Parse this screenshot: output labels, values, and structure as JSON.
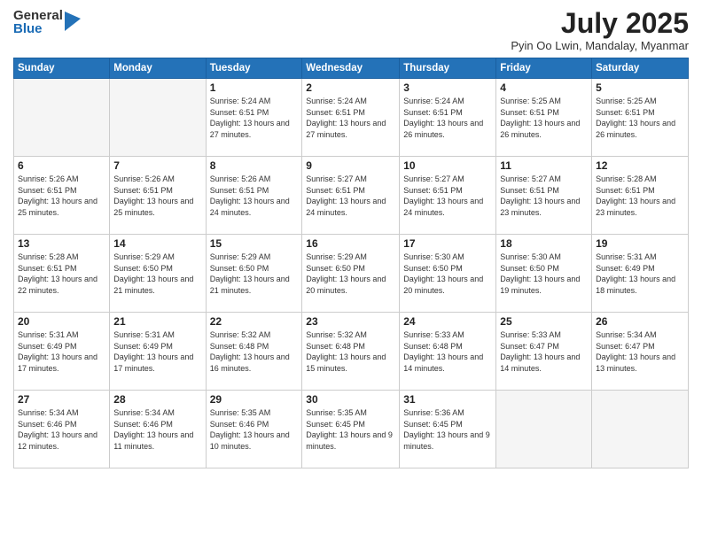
{
  "logo": {
    "general": "General",
    "blue": "Blue"
  },
  "title": {
    "month": "July 2025",
    "location": "Pyin Oo Lwin, Mandalay, Myanmar"
  },
  "headers": [
    "Sunday",
    "Monday",
    "Tuesday",
    "Wednesday",
    "Thursday",
    "Friday",
    "Saturday"
  ],
  "weeks": [
    [
      {
        "day": "",
        "info": ""
      },
      {
        "day": "",
        "info": ""
      },
      {
        "day": "1",
        "info": "Sunrise: 5:24 AM\nSunset: 6:51 PM\nDaylight: 13 hours and 27 minutes."
      },
      {
        "day": "2",
        "info": "Sunrise: 5:24 AM\nSunset: 6:51 PM\nDaylight: 13 hours and 27 minutes."
      },
      {
        "day": "3",
        "info": "Sunrise: 5:24 AM\nSunset: 6:51 PM\nDaylight: 13 hours and 26 minutes."
      },
      {
        "day": "4",
        "info": "Sunrise: 5:25 AM\nSunset: 6:51 PM\nDaylight: 13 hours and 26 minutes."
      },
      {
        "day": "5",
        "info": "Sunrise: 5:25 AM\nSunset: 6:51 PM\nDaylight: 13 hours and 26 minutes."
      }
    ],
    [
      {
        "day": "6",
        "info": "Sunrise: 5:26 AM\nSunset: 6:51 PM\nDaylight: 13 hours and 25 minutes."
      },
      {
        "day": "7",
        "info": "Sunrise: 5:26 AM\nSunset: 6:51 PM\nDaylight: 13 hours and 25 minutes."
      },
      {
        "day": "8",
        "info": "Sunrise: 5:26 AM\nSunset: 6:51 PM\nDaylight: 13 hours and 24 minutes."
      },
      {
        "day": "9",
        "info": "Sunrise: 5:27 AM\nSunset: 6:51 PM\nDaylight: 13 hours and 24 minutes."
      },
      {
        "day": "10",
        "info": "Sunrise: 5:27 AM\nSunset: 6:51 PM\nDaylight: 13 hours and 24 minutes."
      },
      {
        "day": "11",
        "info": "Sunrise: 5:27 AM\nSunset: 6:51 PM\nDaylight: 13 hours and 23 minutes."
      },
      {
        "day": "12",
        "info": "Sunrise: 5:28 AM\nSunset: 6:51 PM\nDaylight: 13 hours and 23 minutes."
      }
    ],
    [
      {
        "day": "13",
        "info": "Sunrise: 5:28 AM\nSunset: 6:51 PM\nDaylight: 13 hours and 22 minutes."
      },
      {
        "day": "14",
        "info": "Sunrise: 5:29 AM\nSunset: 6:50 PM\nDaylight: 13 hours and 21 minutes."
      },
      {
        "day": "15",
        "info": "Sunrise: 5:29 AM\nSunset: 6:50 PM\nDaylight: 13 hours and 21 minutes."
      },
      {
        "day": "16",
        "info": "Sunrise: 5:29 AM\nSunset: 6:50 PM\nDaylight: 13 hours and 20 minutes."
      },
      {
        "day": "17",
        "info": "Sunrise: 5:30 AM\nSunset: 6:50 PM\nDaylight: 13 hours and 20 minutes."
      },
      {
        "day": "18",
        "info": "Sunrise: 5:30 AM\nSunset: 6:50 PM\nDaylight: 13 hours and 19 minutes."
      },
      {
        "day": "19",
        "info": "Sunrise: 5:31 AM\nSunset: 6:49 PM\nDaylight: 13 hours and 18 minutes."
      }
    ],
    [
      {
        "day": "20",
        "info": "Sunrise: 5:31 AM\nSunset: 6:49 PM\nDaylight: 13 hours and 17 minutes."
      },
      {
        "day": "21",
        "info": "Sunrise: 5:31 AM\nSunset: 6:49 PM\nDaylight: 13 hours and 17 minutes."
      },
      {
        "day": "22",
        "info": "Sunrise: 5:32 AM\nSunset: 6:48 PM\nDaylight: 13 hours and 16 minutes."
      },
      {
        "day": "23",
        "info": "Sunrise: 5:32 AM\nSunset: 6:48 PM\nDaylight: 13 hours and 15 minutes."
      },
      {
        "day": "24",
        "info": "Sunrise: 5:33 AM\nSunset: 6:48 PM\nDaylight: 13 hours and 14 minutes."
      },
      {
        "day": "25",
        "info": "Sunrise: 5:33 AM\nSunset: 6:47 PM\nDaylight: 13 hours and 14 minutes."
      },
      {
        "day": "26",
        "info": "Sunrise: 5:34 AM\nSunset: 6:47 PM\nDaylight: 13 hours and 13 minutes."
      }
    ],
    [
      {
        "day": "27",
        "info": "Sunrise: 5:34 AM\nSunset: 6:46 PM\nDaylight: 13 hours and 12 minutes."
      },
      {
        "day": "28",
        "info": "Sunrise: 5:34 AM\nSunset: 6:46 PM\nDaylight: 13 hours and 11 minutes."
      },
      {
        "day": "29",
        "info": "Sunrise: 5:35 AM\nSunset: 6:46 PM\nDaylight: 13 hours and 10 minutes."
      },
      {
        "day": "30",
        "info": "Sunrise: 5:35 AM\nSunset: 6:45 PM\nDaylight: 13 hours and 9 minutes."
      },
      {
        "day": "31",
        "info": "Sunrise: 5:36 AM\nSunset: 6:45 PM\nDaylight: 13 hours and 9 minutes."
      },
      {
        "day": "",
        "info": ""
      },
      {
        "day": "",
        "info": ""
      }
    ]
  ]
}
